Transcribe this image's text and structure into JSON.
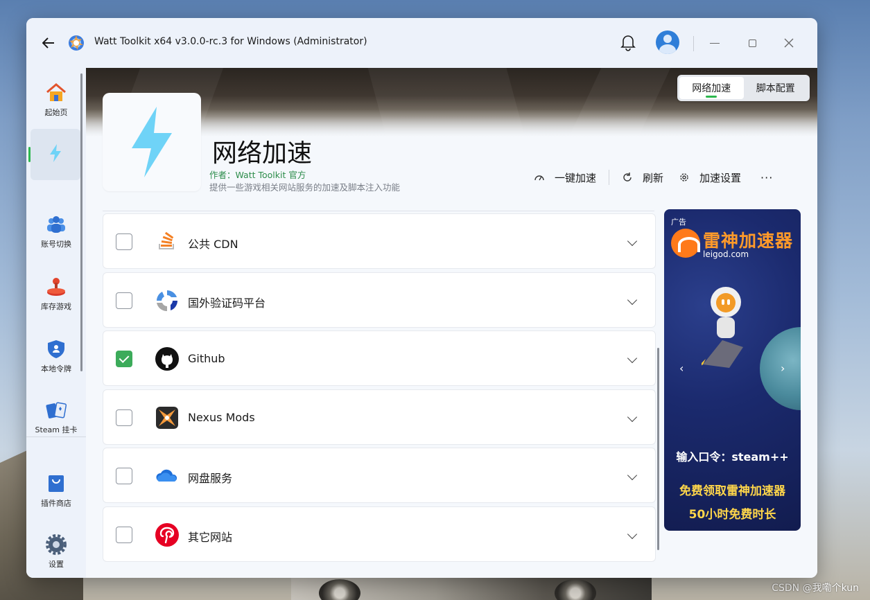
{
  "window": {
    "title": "Watt Toolkit x64 v3.0.0-rc.3 for Windows (Administrator)"
  },
  "sidebar": {
    "items": [
      {
        "label": "起始页",
        "icon": "home-icon"
      },
      {
        "label": "",
        "icon": "lightning-icon",
        "active": true
      },
      {
        "label": "账号切换",
        "icon": "users-icon"
      },
      {
        "label": "库存游戏",
        "icon": "joystick-icon"
      },
      {
        "label": "本地令牌",
        "icon": "shield-icon"
      },
      {
        "label": "Steam 挂卡",
        "icon": "cards-icon"
      },
      {
        "label": "插件商店",
        "icon": "shop-bag-icon"
      },
      {
        "label": "设置",
        "icon": "gear-icon"
      }
    ]
  },
  "tabs": [
    {
      "label": "网络加速",
      "active": true
    },
    {
      "label": "脚本配置",
      "active": false
    }
  ],
  "plugin": {
    "title": "网络加速",
    "author": "作者：Watt Toolkit  官方",
    "description": "提供一些游戏相关网站服务的加速及脚本注入功能"
  },
  "actions": {
    "one_click": "一键加速",
    "refresh": "刷新",
    "settings": "加速设置",
    "more": "···"
  },
  "services": [
    {
      "label": "公共 CDN",
      "checked": false,
      "icon": "stack-cdn-icon"
    },
    {
      "label": "国外验证码平台",
      "checked": false,
      "icon": "recaptcha-icon"
    },
    {
      "label": "Github",
      "checked": true,
      "icon": "github-icon"
    },
    {
      "label": "Nexus Mods",
      "checked": false,
      "icon": "nexus-mods-icon"
    },
    {
      "label": "网盘服务",
      "checked": false,
      "icon": "cloud-icon"
    },
    {
      "label": "其它网站",
      "checked": false,
      "icon": "pinterest-icon"
    }
  ],
  "ad": {
    "tag": "广告",
    "brand": "雷神加速器",
    "domain": "leigod.com",
    "line1": "输入口令：steam++",
    "line2": "免费领取雷神加速器",
    "line3": "50小时免费时长"
  },
  "watermark": "CSDN @我嘞个kun",
  "colors": {
    "accent_green": "#2db74e",
    "checkbox_on": "#3cab5a",
    "author_text": "#2c8c4a",
    "lightning": "#6fd3f7"
  }
}
